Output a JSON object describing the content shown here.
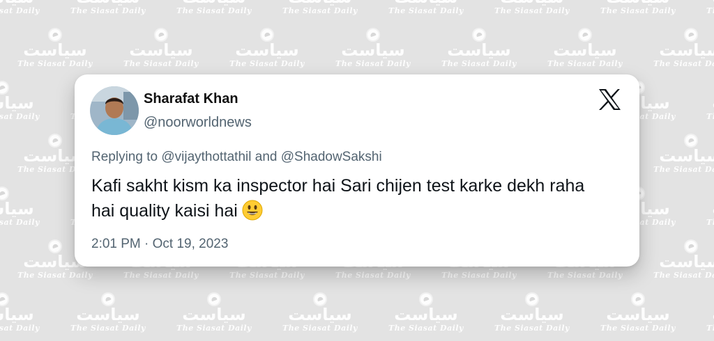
{
  "watermark": {
    "urdu_text": "سیاست",
    "caption": "The Siasat Daily"
  },
  "tweet": {
    "author": {
      "display_name": "Sharafat Khan",
      "handle": "@noorworldnews"
    },
    "platform_icon": "x-logo-icon",
    "reply": {
      "prefix": "Replying to",
      "mention_1": "@vijaythottathil",
      "conjunction": "and",
      "mention_2": "@ShadowSakshi"
    },
    "text": "Kafi sakht kism ka inspector hai Sari chijen test karke dekh raha hai quality kaisi hai",
    "emoji": "smiling-face-emoji",
    "timestamp": "2:01 PM · Oct 19, 2023"
  },
  "colors": {
    "background": "#e3e3e3",
    "card": "#ffffff",
    "primary_text": "#0f1419",
    "secondary_text": "#536471",
    "emoji_face": "#ffcc33"
  }
}
